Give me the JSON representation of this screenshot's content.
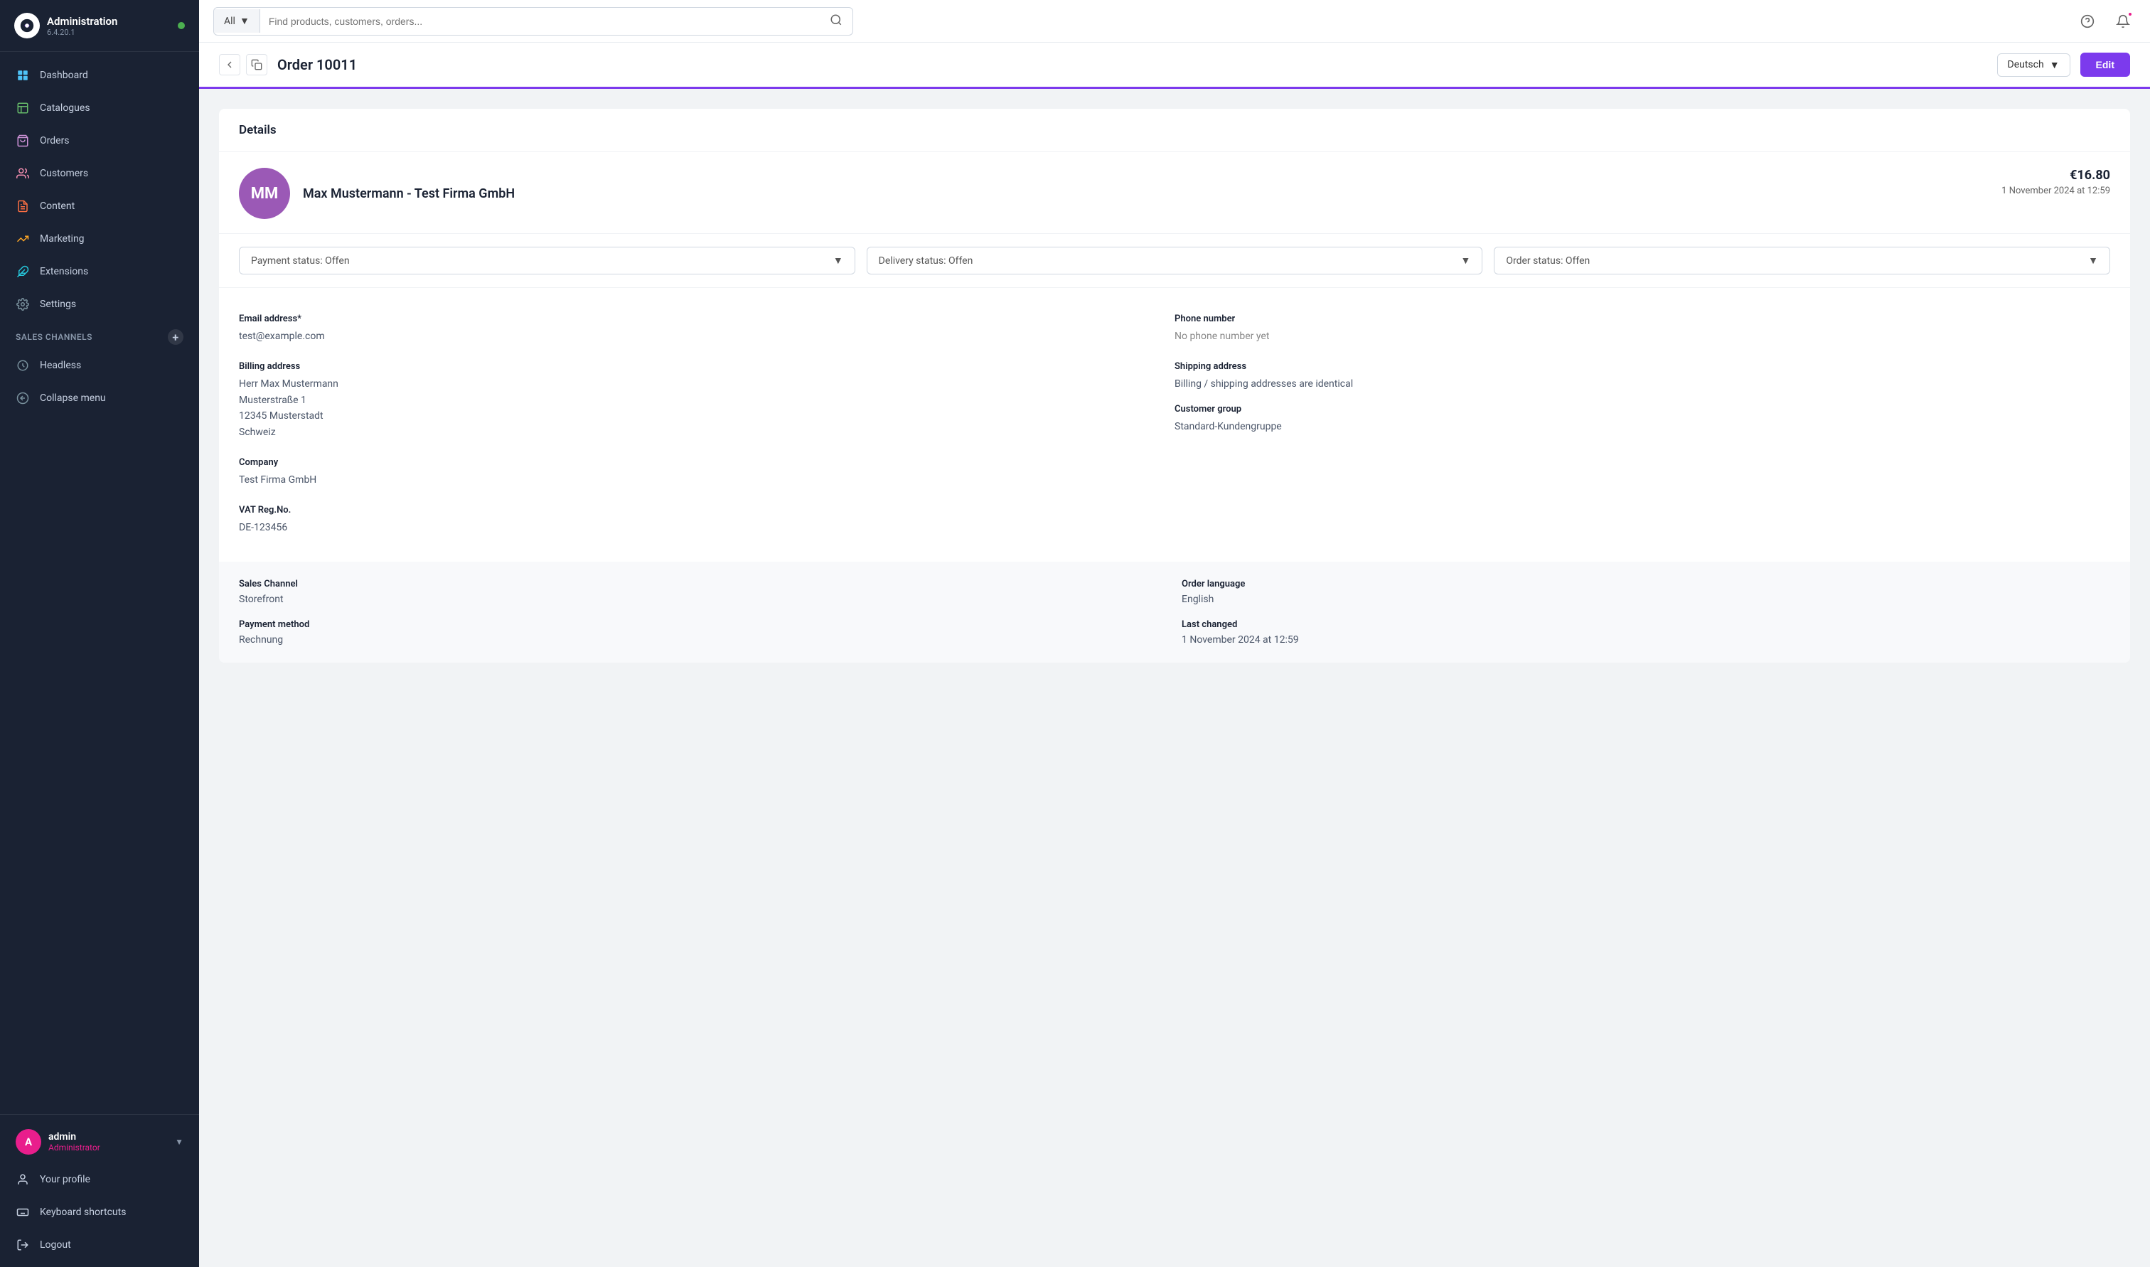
{
  "app": {
    "name": "Administration",
    "version": "6.4.20.1"
  },
  "sidebar": {
    "nav_items": [
      {
        "id": "dashboard",
        "label": "Dashboard",
        "icon": "dashboard"
      },
      {
        "id": "catalogues",
        "label": "Catalogues",
        "icon": "catalogues"
      },
      {
        "id": "orders",
        "label": "Orders",
        "icon": "orders"
      },
      {
        "id": "customers",
        "label": "Customers",
        "icon": "customers"
      },
      {
        "id": "content",
        "label": "Content",
        "icon": "content"
      },
      {
        "id": "marketing",
        "label": "Marketing",
        "icon": "marketing"
      },
      {
        "id": "extensions",
        "label": "Extensions",
        "icon": "extensions"
      },
      {
        "id": "settings",
        "label": "Settings",
        "icon": "settings"
      }
    ],
    "sales_channels_label": "Sales Channels",
    "sales_channels": [
      {
        "id": "headless",
        "label": "Headless",
        "icon": "headless"
      }
    ],
    "collapse_label": "Collapse menu",
    "user": {
      "initials": "A",
      "name": "admin",
      "role": "Administrator"
    },
    "bottom_items": [
      {
        "id": "profile",
        "label": "Your profile",
        "icon": "profile"
      },
      {
        "id": "keyboard",
        "label": "Keyboard shortcuts",
        "icon": "keyboard"
      },
      {
        "id": "logout",
        "label": "Logout",
        "icon": "logout"
      }
    ]
  },
  "topbar": {
    "search_filter": "All",
    "search_placeholder": "Find products, customers, orders..."
  },
  "page_header": {
    "title": "Order 10011",
    "language": "Deutsch",
    "edit_label": "Edit"
  },
  "details_section": {
    "header": "Details",
    "customer": {
      "initials": "MM",
      "name": "Max Mustermann - Test Firma GmbH"
    },
    "order_amount": "€16.80",
    "order_date": "1 November 2024 at 12:59",
    "payment_status_label": "Payment status: Offen",
    "delivery_status_label": "Delivery status: Offen",
    "order_status_label": "Order status: Offen",
    "email_label": "Email address*",
    "email_value": "test@example.com",
    "phone_label": "Phone number",
    "phone_value": "No phone number yet",
    "billing_label": "Billing address",
    "billing_lines": [
      "Herr Max Mustermann",
      "Musterstraße 1",
      "12345 Musterstadt",
      "Schweiz"
    ],
    "shipping_label": "Shipping address",
    "shipping_value": "Billing / shipping addresses are identical",
    "customer_group_label": "Customer group",
    "customer_group_value": "Standard-Kundengruppe",
    "company_label": "Company",
    "company_value": "Test Firma GmbH",
    "vat_label": "VAT Reg.No.",
    "vat_value": "DE-123456",
    "sales_channel_label": "Sales Channel",
    "sales_channel_value": "Storefront",
    "order_language_label": "Order language",
    "order_language_value": "English",
    "payment_method_label": "Payment method",
    "payment_method_value": "Rechnung",
    "last_changed_label": "Last changed",
    "last_changed_value": "1 November 2024 at 12:59"
  }
}
